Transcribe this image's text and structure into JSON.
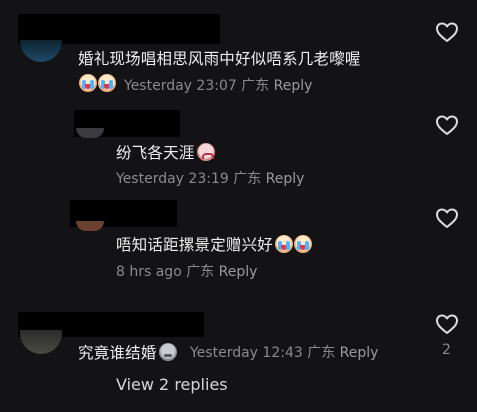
{
  "comments": [
    {
      "text": "婚礼现场唱相思风雨中好似唔系几老嚟喔",
      "time": "Yesterday 23:07",
      "location": "广东",
      "reply": "Reply",
      "emojis": [
        "cry",
        "cry"
      ]
    },
    {
      "text": "纷飞各天涯",
      "time": "Yesterday 23:19",
      "location": "广东",
      "reply": "Reply",
      "emojis": [
        "sad"
      ]
    },
    {
      "text": "唔知话距摞景定赠兴好",
      "time": "8 hrs ago",
      "location": "广东",
      "reply": "Reply",
      "emojis": [
        "cry",
        "cry"
      ]
    },
    {
      "text": "究竟谁结婚",
      "time": "Yesterday 12:43",
      "location": "广东",
      "reply": "Reply",
      "emojis": [
        "grey"
      ],
      "like_count": "2"
    }
  ],
  "view_replies": "View 2 replies",
  "icons": {
    "like": "heart-outline-icon"
  }
}
